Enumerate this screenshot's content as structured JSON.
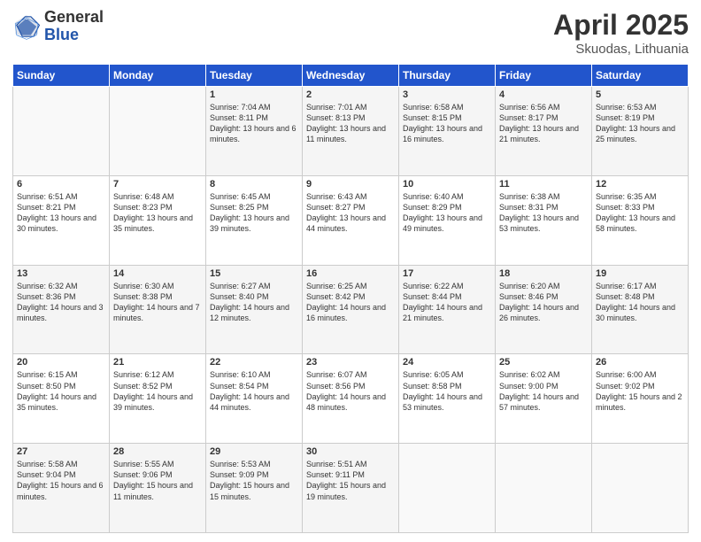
{
  "logo": {
    "general": "General",
    "blue": "Blue"
  },
  "header": {
    "title": "April 2025",
    "location": "Skuodas, Lithuania"
  },
  "columns": [
    "Sunday",
    "Monday",
    "Tuesday",
    "Wednesday",
    "Thursday",
    "Friday",
    "Saturday"
  ],
  "weeks": [
    [
      {
        "day": "",
        "info": ""
      },
      {
        "day": "",
        "info": ""
      },
      {
        "day": "1",
        "info": "Sunrise: 7:04 AM\nSunset: 8:11 PM\nDaylight: 13 hours and 6 minutes."
      },
      {
        "day": "2",
        "info": "Sunrise: 7:01 AM\nSunset: 8:13 PM\nDaylight: 13 hours and 11 minutes."
      },
      {
        "day": "3",
        "info": "Sunrise: 6:58 AM\nSunset: 8:15 PM\nDaylight: 13 hours and 16 minutes."
      },
      {
        "day": "4",
        "info": "Sunrise: 6:56 AM\nSunset: 8:17 PM\nDaylight: 13 hours and 21 minutes."
      },
      {
        "day": "5",
        "info": "Sunrise: 6:53 AM\nSunset: 8:19 PM\nDaylight: 13 hours and 25 minutes."
      }
    ],
    [
      {
        "day": "6",
        "info": "Sunrise: 6:51 AM\nSunset: 8:21 PM\nDaylight: 13 hours and 30 minutes."
      },
      {
        "day": "7",
        "info": "Sunrise: 6:48 AM\nSunset: 8:23 PM\nDaylight: 13 hours and 35 minutes."
      },
      {
        "day": "8",
        "info": "Sunrise: 6:45 AM\nSunset: 8:25 PM\nDaylight: 13 hours and 39 minutes."
      },
      {
        "day": "9",
        "info": "Sunrise: 6:43 AM\nSunset: 8:27 PM\nDaylight: 13 hours and 44 minutes."
      },
      {
        "day": "10",
        "info": "Sunrise: 6:40 AM\nSunset: 8:29 PM\nDaylight: 13 hours and 49 minutes."
      },
      {
        "day": "11",
        "info": "Sunrise: 6:38 AM\nSunset: 8:31 PM\nDaylight: 13 hours and 53 minutes."
      },
      {
        "day": "12",
        "info": "Sunrise: 6:35 AM\nSunset: 8:33 PM\nDaylight: 13 hours and 58 minutes."
      }
    ],
    [
      {
        "day": "13",
        "info": "Sunrise: 6:32 AM\nSunset: 8:36 PM\nDaylight: 14 hours and 3 minutes."
      },
      {
        "day": "14",
        "info": "Sunrise: 6:30 AM\nSunset: 8:38 PM\nDaylight: 14 hours and 7 minutes."
      },
      {
        "day": "15",
        "info": "Sunrise: 6:27 AM\nSunset: 8:40 PM\nDaylight: 14 hours and 12 minutes."
      },
      {
        "day": "16",
        "info": "Sunrise: 6:25 AM\nSunset: 8:42 PM\nDaylight: 14 hours and 16 minutes."
      },
      {
        "day": "17",
        "info": "Sunrise: 6:22 AM\nSunset: 8:44 PM\nDaylight: 14 hours and 21 minutes."
      },
      {
        "day": "18",
        "info": "Sunrise: 6:20 AM\nSunset: 8:46 PM\nDaylight: 14 hours and 26 minutes."
      },
      {
        "day": "19",
        "info": "Sunrise: 6:17 AM\nSunset: 8:48 PM\nDaylight: 14 hours and 30 minutes."
      }
    ],
    [
      {
        "day": "20",
        "info": "Sunrise: 6:15 AM\nSunset: 8:50 PM\nDaylight: 14 hours and 35 minutes."
      },
      {
        "day": "21",
        "info": "Sunrise: 6:12 AM\nSunset: 8:52 PM\nDaylight: 14 hours and 39 minutes."
      },
      {
        "day": "22",
        "info": "Sunrise: 6:10 AM\nSunset: 8:54 PM\nDaylight: 14 hours and 44 minutes."
      },
      {
        "day": "23",
        "info": "Sunrise: 6:07 AM\nSunset: 8:56 PM\nDaylight: 14 hours and 48 minutes."
      },
      {
        "day": "24",
        "info": "Sunrise: 6:05 AM\nSunset: 8:58 PM\nDaylight: 14 hours and 53 minutes."
      },
      {
        "day": "25",
        "info": "Sunrise: 6:02 AM\nSunset: 9:00 PM\nDaylight: 14 hours and 57 minutes."
      },
      {
        "day": "26",
        "info": "Sunrise: 6:00 AM\nSunset: 9:02 PM\nDaylight: 15 hours and 2 minutes."
      }
    ],
    [
      {
        "day": "27",
        "info": "Sunrise: 5:58 AM\nSunset: 9:04 PM\nDaylight: 15 hours and 6 minutes."
      },
      {
        "day": "28",
        "info": "Sunrise: 5:55 AM\nSunset: 9:06 PM\nDaylight: 15 hours and 11 minutes."
      },
      {
        "day": "29",
        "info": "Sunrise: 5:53 AM\nSunset: 9:09 PM\nDaylight: 15 hours and 15 minutes."
      },
      {
        "day": "30",
        "info": "Sunrise: 5:51 AM\nSunset: 9:11 PM\nDaylight: 15 hours and 19 minutes."
      },
      {
        "day": "",
        "info": ""
      },
      {
        "day": "",
        "info": ""
      },
      {
        "day": "",
        "info": ""
      }
    ]
  ]
}
